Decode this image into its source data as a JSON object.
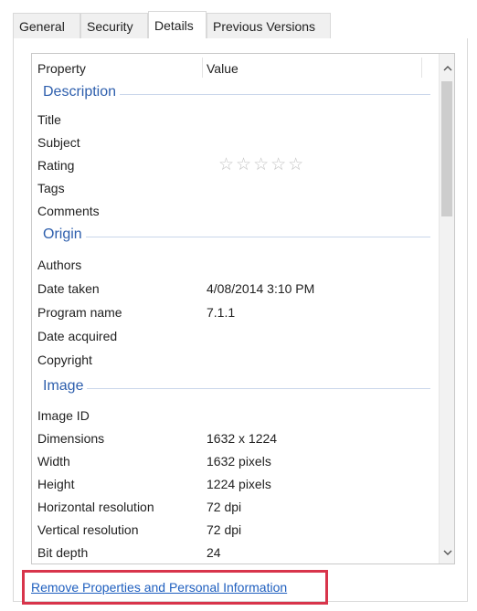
{
  "tabs": [
    {
      "label": "General"
    },
    {
      "label": "Security"
    },
    {
      "label": "Details",
      "active": true
    },
    {
      "label": "Previous Versions"
    }
  ],
  "columns": {
    "property": "Property",
    "value": "Value"
  },
  "groups": {
    "description": {
      "title": "Description",
      "rows": [
        {
          "key": "Title",
          "value": ""
        },
        {
          "key": "Subject",
          "value": ""
        },
        {
          "key": "Rating",
          "value": "☆☆☆☆☆",
          "rating": 0
        },
        {
          "key": "Tags",
          "value": ""
        },
        {
          "key": "Comments",
          "value": ""
        }
      ]
    },
    "origin": {
      "title": "Origin",
      "rows": [
        {
          "key": "Authors",
          "value": ""
        },
        {
          "key": "Date taken",
          "value": "4/08/2014 3:10 PM"
        },
        {
          "key": "Program name",
          "value": "7.1.1"
        },
        {
          "key": "Date acquired",
          "value": ""
        },
        {
          "key": "Copyright",
          "value": ""
        }
      ]
    },
    "image": {
      "title": "Image",
      "rows": [
        {
          "key": "Image ID",
          "value": ""
        },
        {
          "key": "Dimensions",
          "value": "1632 x 1224"
        },
        {
          "key": "Width",
          "value": "1632 pixels"
        },
        {
          "key": "Height",
          "value": "1224 pixels"
        },
        {
          "key": "Horizontal resolution",
          "value": "72 dpi"
        },
        {
          "key": "Vertical resolution",
          "value": "72 dpi"
        },
        {
          "key": "Bit depth",
          "value": "24"
        }
      ]
    }
  },
  "scroll": {
    "up_icon": "chevron-up-icon",
    "down_icon": "chevron-down-icon"
  },
  "footer": {
    "remove_link": "Remove Properties and Personal Information"
  },
  "colors": {
    "group_title": "#2e5fad",
    "link": "#1f5fbf",
    "highlight_border": "#d8344b"
  }
}
